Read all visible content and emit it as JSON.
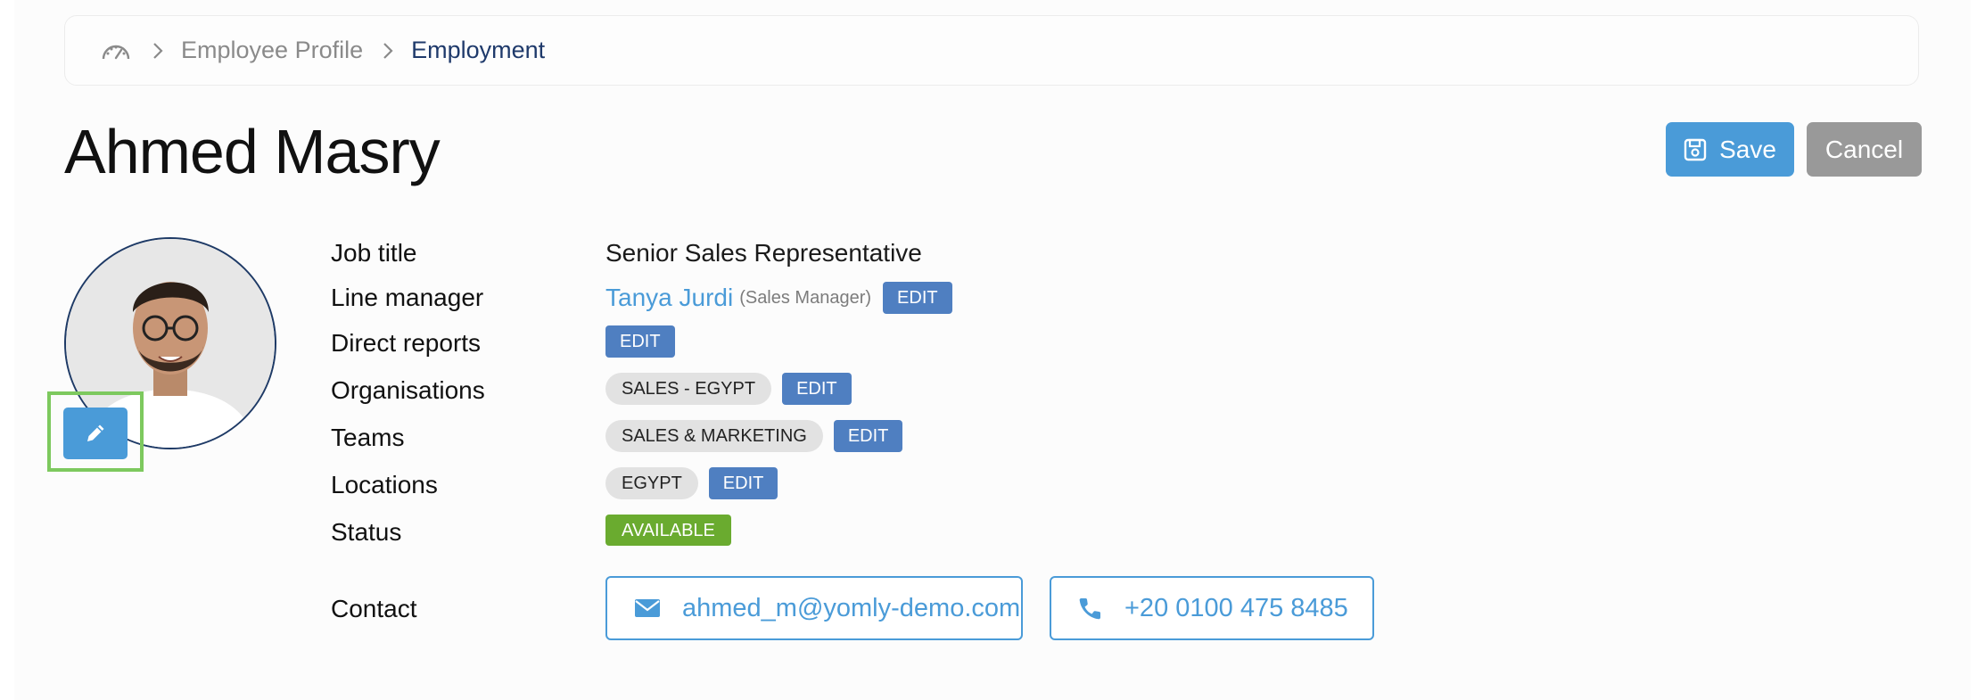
{
  "breadcrumb": {
    "home_icon": "dashboard-gauge-icon",
    "items": [
      "Employee Profile",
      "Employment"
    ]
  },
  "employee": {
    "name": "Ahmed Masry"
  },
  "actions": {
    "save_label": "Save",
    "cancel_label": "Cancel"
  },
  "fields": {
    "job_title": {
      "label": "Job title",
      "value": "Senior Sales Representative"
    },
    "line_manager": {
      "label": "Line manager",
      "name": "Tanya Jurdi",
      "role": "(Sales Manager)",
      "edit": "EDIT"
    },
    "direct_reports": {
      "label": "Direct reports",
      "edit": "EDIT"
    },
    "organisations": {
      "label": "Organisations",
      "tags": [
        "SALES - EGYPT"
      ],
      "edit": "EDIT"
    },
    "teams": {
      "label": "Teams",
      "tags": [
        "SALES & MARKETING"
      ],
      "edit": "EDIT"
    },
    "locations": {
      "label": "Locations",
      "tags": [
        "EGYPT"
      ],
      "edit": "EDIT"
    },
    "status": {
      "label": "Status",
      "value": "AVAILABLE"
    },
    "contact": {
      "label": "Contact",
      "email": "ahmed_m@yomly-demo.com",
      "phone": "+20 0100 475 8485"
    }
  },
  "colors": {
    "primary": "#4a9bd8",
    "edit": "#4f7fc1",
    "status_available": "#6aab2f",
    "cancel": "#999999",
    "focus_outline": "#7dc95e"
  }
}
